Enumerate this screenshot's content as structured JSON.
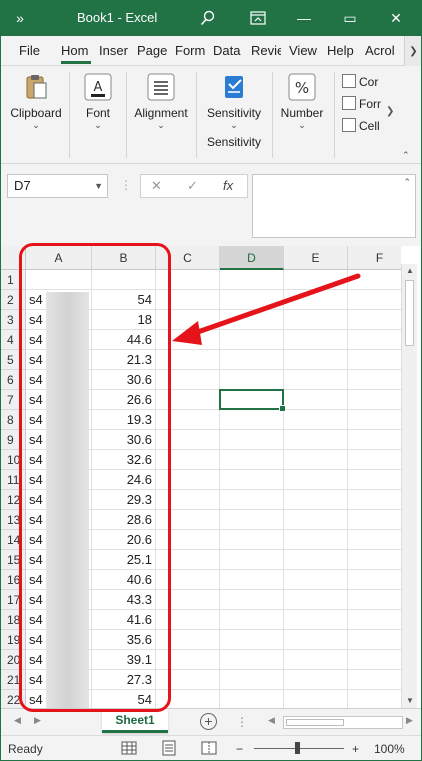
{
  "window": {
    "title": "Book1  -  Excel",
    "controls": {
      "minimize": "—",
      "restore": "▭",
      "close": "✕"
    }
  },
  "tabs": [
    "File",
    "Hom",
    "Inser",
    "Page",
    "Form",
    "Data",
    "Revie",
    "View",
    "Help",
    "Acrol"
  ],
  "ribbon": {
    "clipboard": "Clipboard",
    "font": "Font",
    "alignment": "Alignment",
    "sensitivity": "Sensitivity",
    "sensitivity_group": "Sensitivity",
    "number": "Number",
    "small": [
      "Cor",
      "Forr",
      "Cell"
    ]
  },
  "formula_bar": {
    "name_box": "D7",
    "cancel": "✕",
    "enter": "✓",
    "fx": "fx",
    "formula": ""
  },
  "grid": {
    "columns": [
      "A",
      "B",
      "C",
      "D",
      "E",
      "F"
    ],
    "selected_column": "D",
    "active_cell": "D7",
    "rows": [
      {
        "r": "1",
        "a": "",
        "b": ""
      },
      {
        "r": "2",
        "a": "s4",
        "b": "54"
      },
      {
        "r": "3",
        "a": "s4",
        "b": "18"
      },
      {
        "r": "4",
        "a": "s4",
        "b": "44.6"
      },
      {
        "r": "5",
        "a": "s4",
        "b": "21.3"
      },
      {
        "r": "6",
        "a": "s4",
        "b": "30.6"
      },
      {
        "r": "7",
        "a": "s4",
        "b": "26.6"
      },
      {
        "r": "8",
        "a": "s4",
        "b": "19.3"
      },
      {
        "r": "9",
        "a": "s4",
        "b": "30.6"
      },
      {
        "r": "10",
        "a": "s4",
        "b": "32.6"
      },
      {
        "r": "11",
        "a": "s4",
        "b": "24.6"
      },
      {
        "r": "12",
        "a": "s4",
        "b": "29.3"
      },
      {
        "r": "13",
        "a": "s4",
        "b": "28.6"
      },
      {
        "r": "14",
        "a": "s4",
        "b": "20.6"
      },
      {
        "r": "15",
        "a": "s4",
        "b": "25.1"
      },
      {
        "r": "16",
        "a": "s4",
        "b": "40.6"
      },
      {
        "r": "17",
        "a": "s4",
        "b": "43.3"
      },
      {
        "r": "18",
        "a": "s4",
        "b": "41.6"
      },
      {
        "r": "19",
        "a": "s4",
        "b": "35.6"
      },
      {
        "r": "20",
        "a": "s4",
        "b": "39.1"
      },
      {
        "r": "21",
        "a": "s4",
        "b": "27.3"
      },
      {
        "r": "22",
        "a": "s4",
        "b": "54"
      }
    ]
  },
  "sheets": {
    "active": "Sheet1",
    "add": "+"
  },
  "status": {
    "ready": "Ready",
    "zoom_minus": "−",
    "zoom_plus": "+",
    "zoom": "100%"
  },
  "colors": {
    "excel_green": "#217346",
    "annotation_red": "#e5141b"
  },
  "icons": [
    "search-icon",
    "ribbon-display-icon",
    "minimize-icon",
    "restore-icon",
    "close-icon",
    "paste-icon",
    "font-icon",
    "align-icon",
    "sensitivity-icon",
    "percent-icon",
    "normal-view-icon",
    "page-layout-icon",
    "page-break-icon"
  ]
}
